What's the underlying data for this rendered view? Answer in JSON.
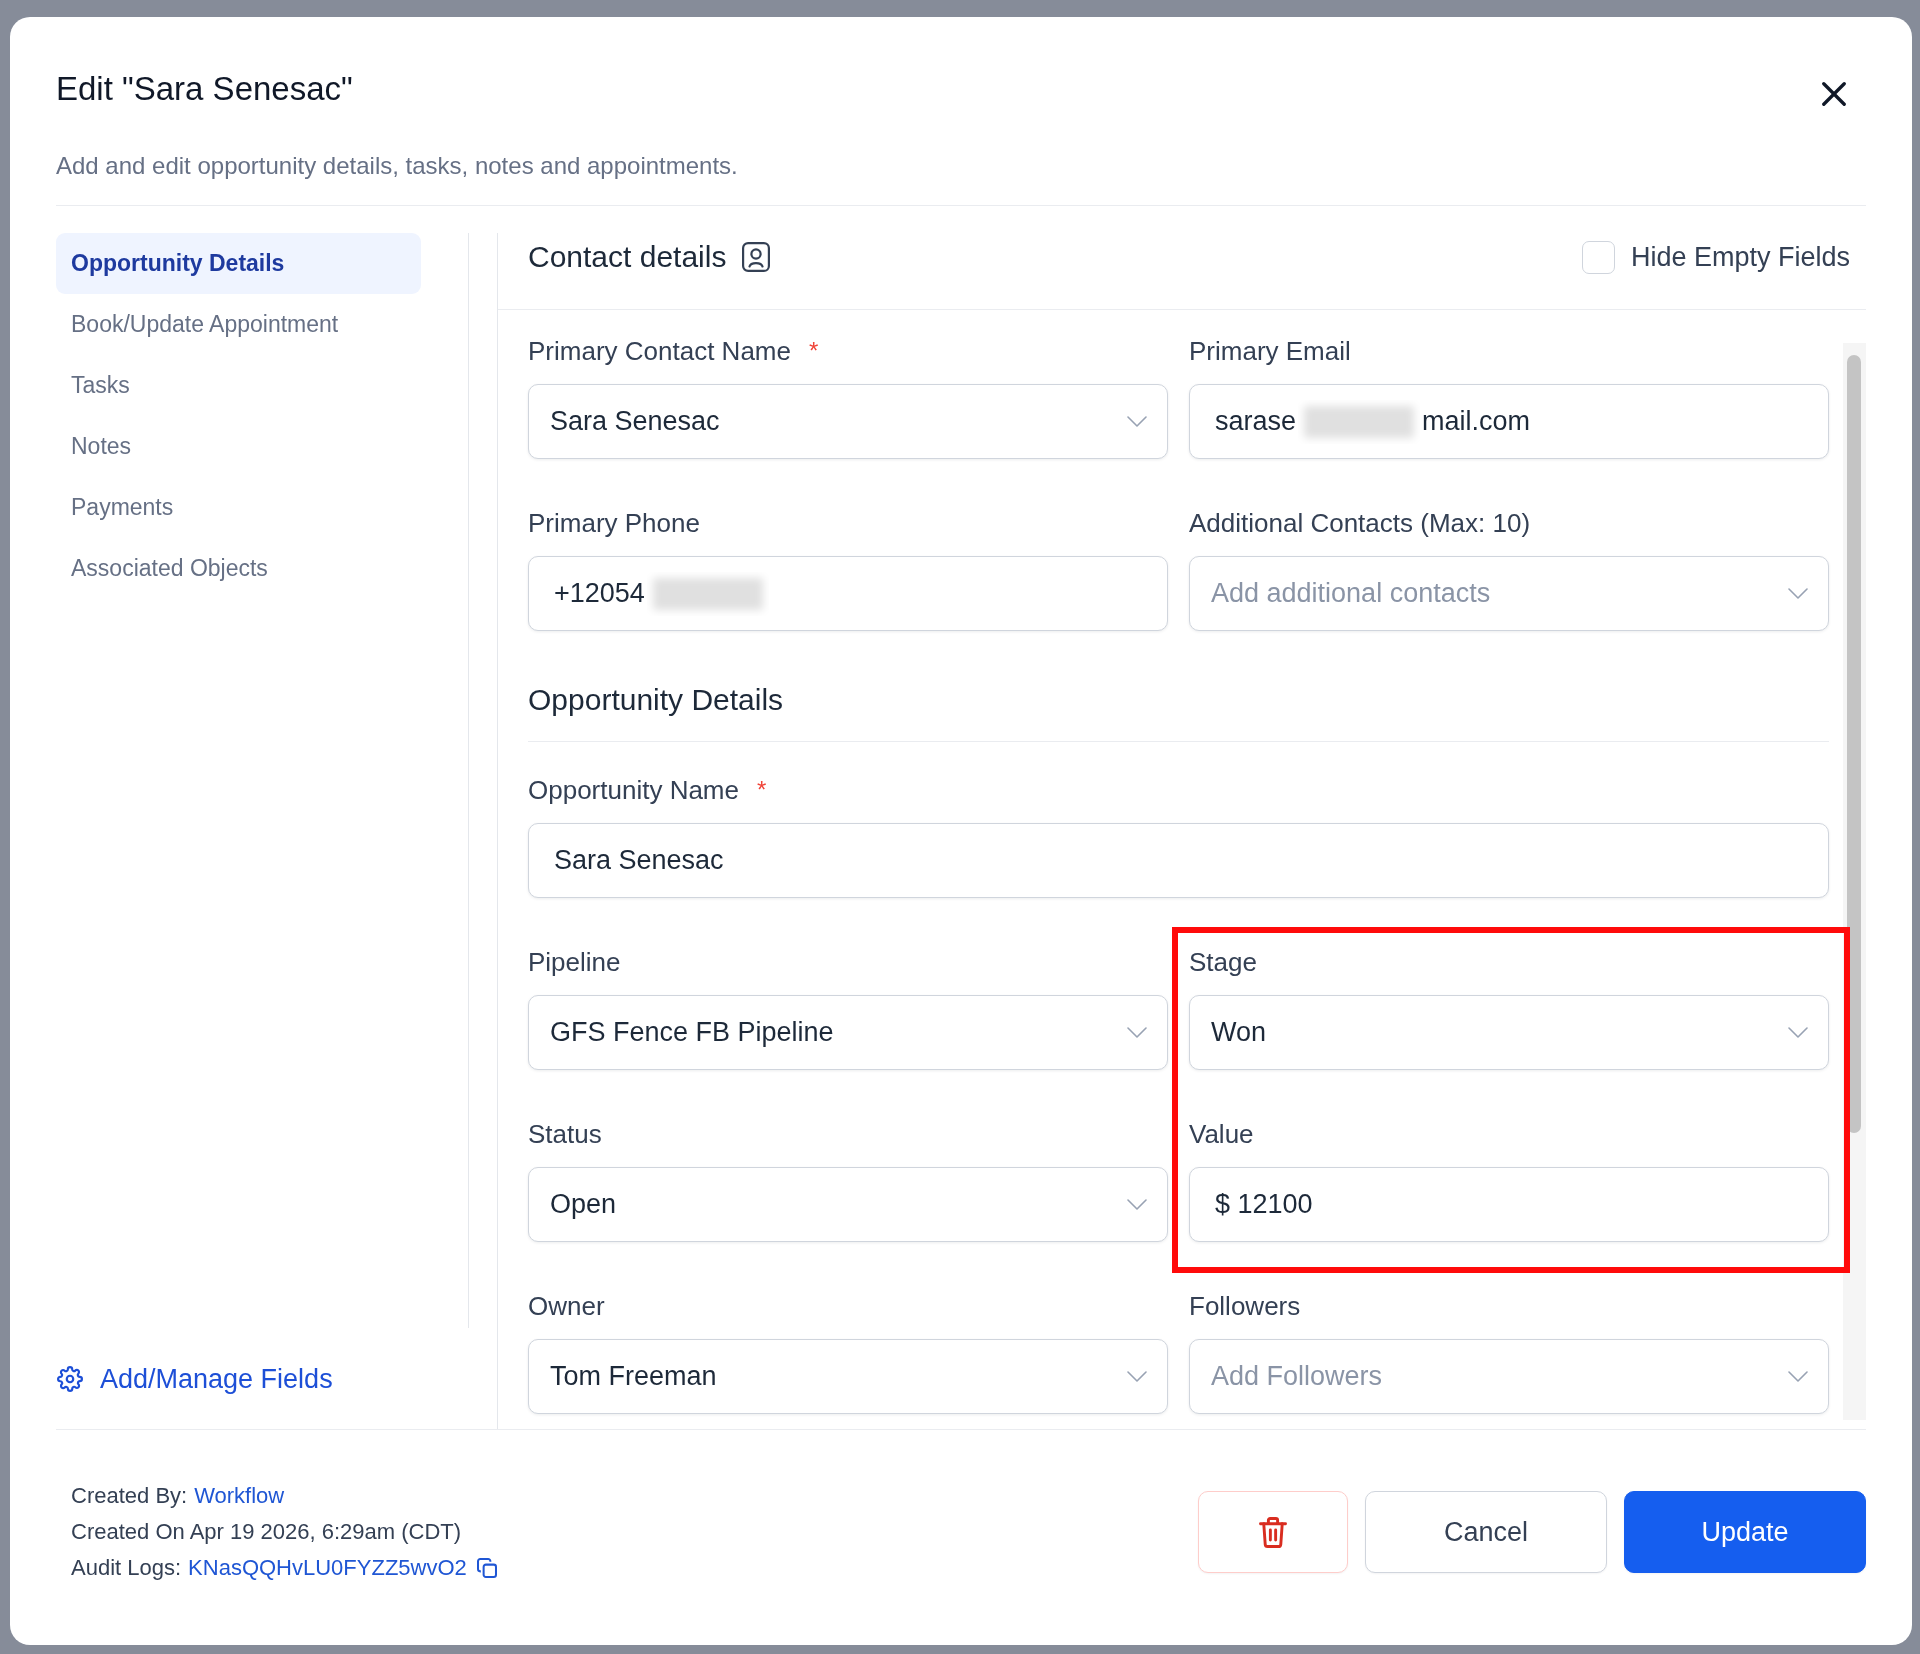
{
  "dialog": {
    "title": "Edit \"Sara Senesac\"",
    "subtitle": "Add and edit opportunity details, tasks, notes and appointments."
  },
  "sidebar": {
    "items": [
      {
        "label": "Opportunity Details",
        "selected": true
      },
      {
        "label": "Book/Update Appointment",
        "selected": false
      },
      {
        "label": "Tasks",
        "selected": false
      },
      {
        "label": "Notes",
        "selected": false
      },
      {
        "label": "Payments",
        "selected": false
      },
      {
        "label": "Associated Objects",
        "selected": false
      }
    ],
    "action": {
      "label": "Add/Manage Fields"
    }
  },
  "form": {
    "title": "Contact details",
    "hide_empty_fields": {
      "label": "Hide Empty Fields",
      "checked": false
    },
    "groups": [
      {
        "fields": [
          {
            "label": "Primary Contact Name",
            "required_mark": "*",
            "kind": "select",
            "value": "Sara Senesac",
            "redacted": false,
            "highlighted": false
          },
          {
            "label": "Primary Email",
            "kind": "text",
            "value": "sarase",
            "redacted": true,
            "value_after": "mail.com",
            "highlighted": false
          },
          {
            "label": "Primary Phone",
            "kind": "text",
            "value": "+12054",
            "redacted": true,
            "highlighted": false
          },
          {
            "label": "Additional Contacts (Max: 10)",
            "kind": "select",
            "placeholder": "Add additional contacts",
            "redacted": false,
            "highlighted": false
          }
        ]
      },
      {
        "title": "Opportunity Details",
        "fields": [
          {
            "label": "Opportunity Name",
            "required_mark": "*",
            "kind": "text",
            "value": "Sara Senesac",
            "full_width": true,
            "redacted": false,
            "highlighted": false
          },
          {
            "label": "Pipeline",
            "kind": "select",
            "value": "GFS Fence FB Pipeline",
            "redacted": false,
            "highlighted": false
          },
          {
            "label": "Stage",
            "kind": "select",
            "value": "Won",
            "redacted": false,
            "highlighted": true
          },
          {
            "label": "Status",
            "kind": "select",
            "value": "Open",
            "redacted": false,
            "highlighted": false
          },
          {
            "label": "Value",
            "kind": "text",
            "value": "$ 12100",
            "redacted": false,
            "highlighted": true
          },
          {
            "label": "Owner",
            "kind": "select",
            "value": "Tom Freeman",
            "redacted": false,
            "highlighted": false
          },
          {
            "label": "Followers",
            "kind": "select",
            "placeholder": "Add Followers",
            "redacted": false,
            "highlighted": false
          }
        ]
      }
    ]
  },
  "footer": {
    "meta": [
      {
        "label": "Created By:",
        "link": "Workflow",
        "copyable": false
      },
      {
        "label": "Created On Apr 19 2026, 6:29am (CDT)",
        "copyable": false
      },
      {
        "label": "Audit Logs:",
        "link": "KNasQQHvLU0FYZZ5wvO2",
        "copyable": true
      }
    ],
    "buttons": [
      {
        "kind": "delete"
      },
      {
        "kind": "secondary",
        "label": "Cancel"
      },
      {
        "kind": "primary",
        "label": "Update"
      }
    ]
  }
}
